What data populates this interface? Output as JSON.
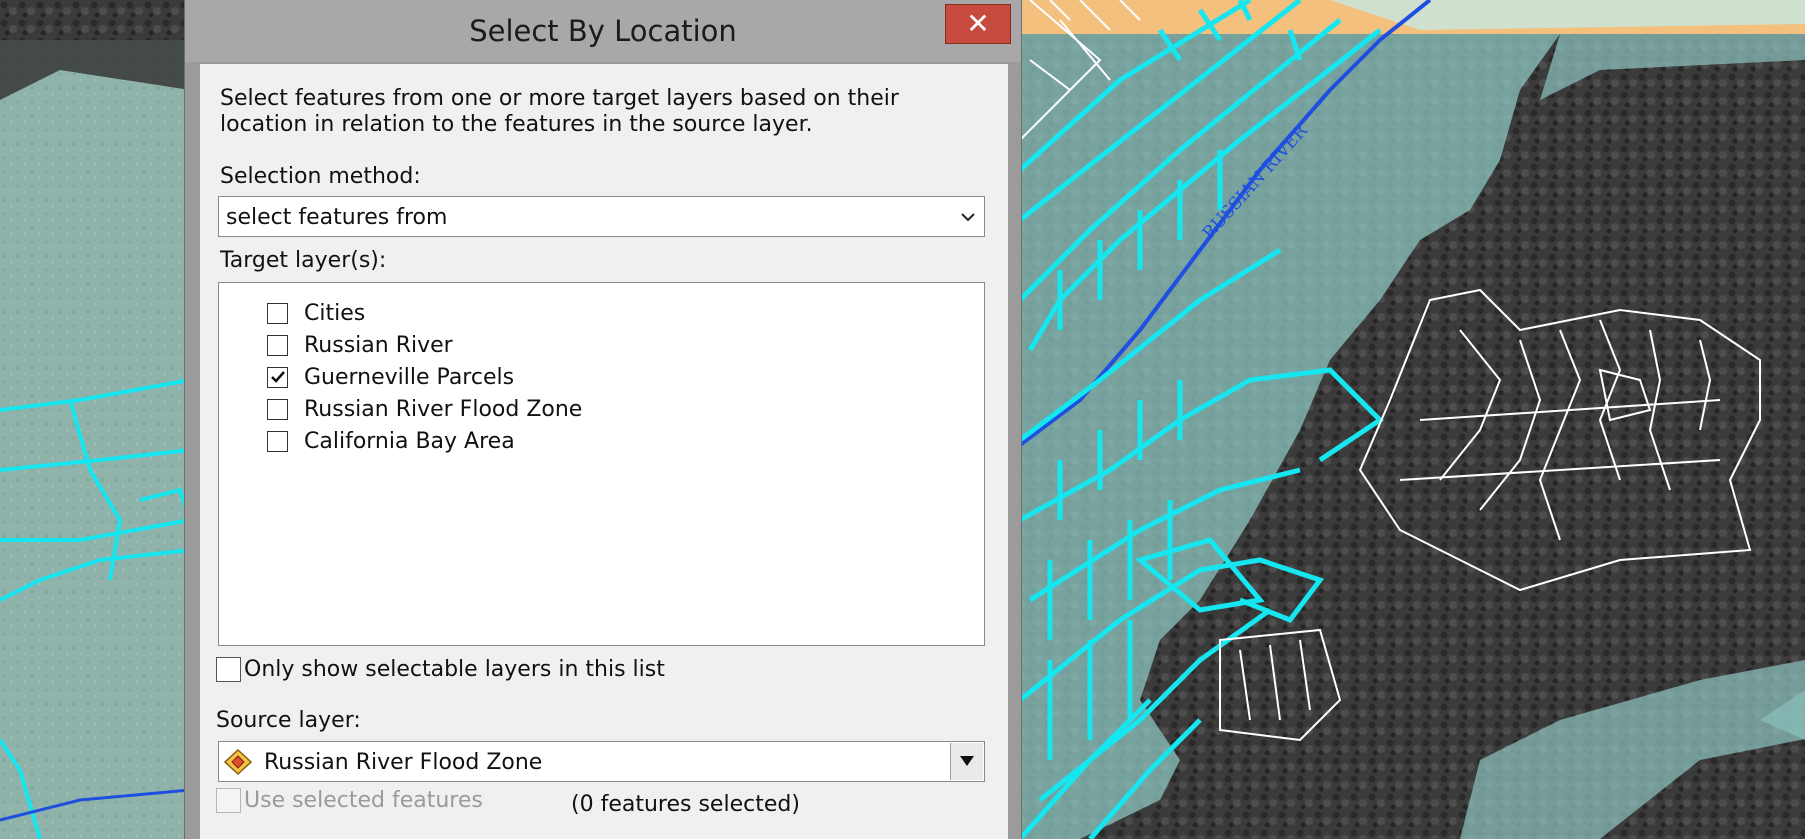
{
  "colors": {
    "map_orange": "#f4c07e",
    "parcel_cyan": "#15e6f0",
    "flood_zone": "#8ec6c0",
    "river_blue": "#1f4fe0",
    "close_red": "#c74a3e"
  },
  "map": {
    "river_label": "RUSSIAN RIVER"
  },
  "dialog": {
    "title": "Select By Location",
    "close_icon": "close-x-icon",
    "description": "Select features from one or more target layers based on their location in relation to the features in the source layer.",
    "selection_method_label": "Selection method:",
    "selection_method_value": "select features from",
    "target_layers_label": "Target layer(s):",
    "target_layers": [
      {
        "label": "Cities",
        "checked": false
      },
      {
        "label": "Russian River",
        "checked": false
      },
      {
        "label": "Guerneville Parcels",
        "checked": true
      },
      {
        "label": "Russian River Flood Zone",
        "checked": false
      },
      {
        "label": "California Bay Area",
        "checked": false
      }
    ],
    "only_selectable_label": "Only show selectable layers in this list",
    "source_layer_label": "Source layer:",
    "source_layer_value": "Russian River Flood Zone",
    "source_layer_icon": "polygon-layer-icon",
    "use_selected_label": "Use selected features",
    "features_selected": "(0 features selected)"
  }
}
